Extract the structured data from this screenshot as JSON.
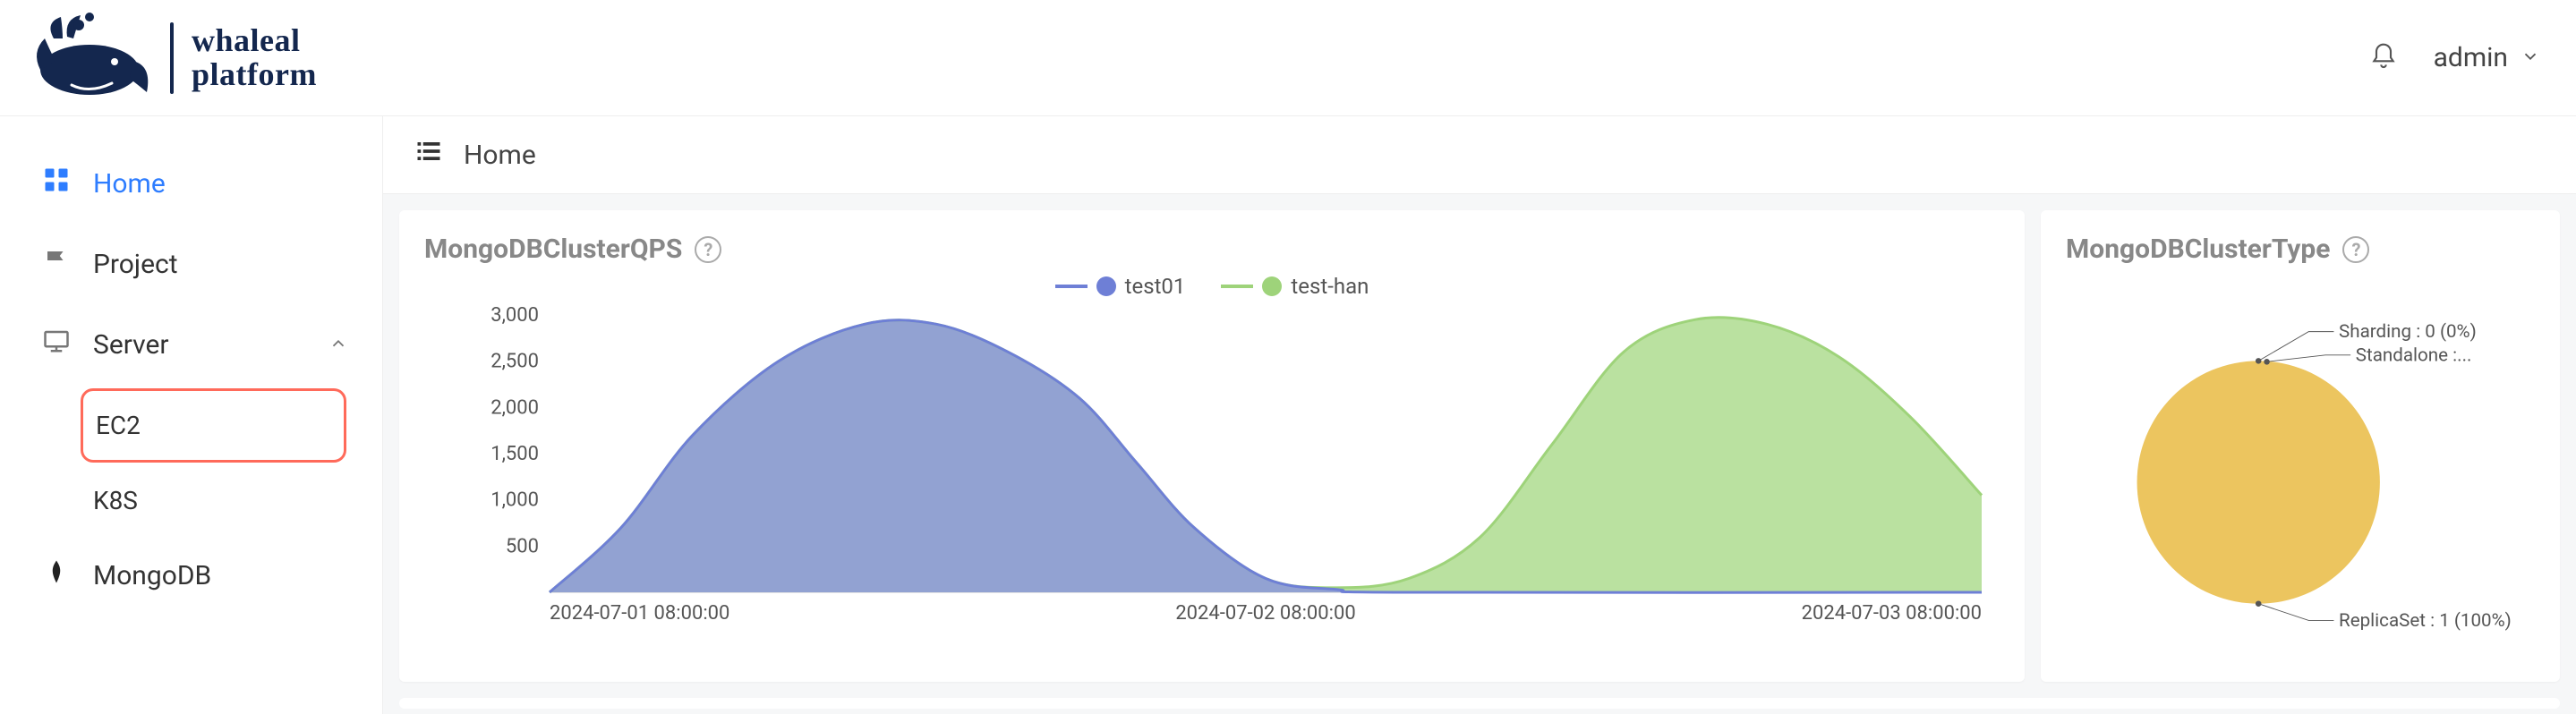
{
  "brand": {
    "line1": "whaleal",
    "line2": "platform"
  },
  "user": {
    "name": "admin"
  },
  "sidebar": {
    "items": [
      {
        "id": "home",
        "label": "Home",
        "icon": "grid",
        "active": true
      },
      {
        "id": "project",
        "label": "Project",
        "icon": "flag",
        "active": false
      },
      {
        "id": "server",
        "label": "Server",
        "icon": "monitor",
        "active": false,
        "expanded": true,
        "children": [
          {
            "id": "ec2",
            "label": "EC2",
            "highlighted": true
          },
          {
            "id": "k8s",
            "label": "K8S",
            "highlighted": false
          }
        ]
      },
      {
        "id": "mongodb",
        "label": "MongoDB",
        "icon": "leaf",
        "active": false
      }
    ]
  },
  "breadcrumb": {
    "label": "Home"
  },
  "cards": {
    "qps": {
      "title": "MongoDBClusterQPS"
    },
    "type": {
      "title": "MongoDBClusterType"
    }
  },
  "colors": {
    "series1": "#6e7fd6",
    "series1_fill": "#8b96da",
    "series2": "#9ed37a",
    "series2_fill": "#aedc8f",
    "pie_main": "#ecc55f"
  },
  "chart_data": [
    {
      "id": "qps",
      "type": "area",
      "title": "MongoDBClusterQPS",
      "xlabel": "",
      "ylabel": "",
      "x": [
        "2024-07-01 08:00:00",
        "2024-07-02 08:00:00",
        "2024-07-03 08:00:00"
      ],
      "x_ticks": [
        "2024-07-01 08:00:00",
        "2024-07-02 08:00:00",
        "2024-07-03 08:00:00"
      ],
      "y_ticks": [
        500,
        1000,
        1500,
        2000,
        2500,
        3000
      ],
      "ylim": [
        0,
        3000
      ],
      "series": [
        {
          "name": "test01",
          "x_rel": [
            0.0,
            0.05,
            0.1,
            0.16,
            0.22,
            0.27,
            0.32,
            0.37,
            0.41,
            0.45,
            0.5,
            0.55,
            0.6,
            1.0
          ],
          "y": [
            0,
            700,
            1700,
            2500,
            2900,
            2900,
            2600,
            2100,
            1400,
            700,
            150,
            30,
            0,
            0
          ]
        },
        {
          "name": "test-han",
          "x_rel": [
            0.0,
            0.05,
            0.1,
            0.16,
            0.22,
            0.27,
            0.32,
            0.37,
            0.41,
            0.45,
            0.5,
            0.55,
            0.6,
            0.65,
            0.7,
            0.75,
            0.8,
            0.85,
            0.9,
            0.95,
            1.0
          ],
          "y": [
            0,
            700,
            1700,
            2500,
            2900,
            2900,
            2600,
            2100,
            1400,
            700,
            150,
            50,
            150,
            600,
            1600,
            2600,
            2950,
            2900,
            2550,
            1900,
            1050
          ]
        }
      ]
    },
    {
      "id": "cluster-type",
      "type": "pie",
      "title": "MongoDBClusterType",
      "slices": [
        {
          "name": "Sharding",
          "count": 0,
          "pct": 0,
          "label": "Sharding : 0 (0%)"
        },
        {
          "name": "Standalone",
          "count": 0,
          "pct": 0,
          "label": "Standalone :..."
        },
        {
          "name": "ReplicaSet",
          "count": 1,
          "pct": 100,
          "label": "ReplicaSet : 1 (100%)"
        }
      ]
    }
  ]
}
